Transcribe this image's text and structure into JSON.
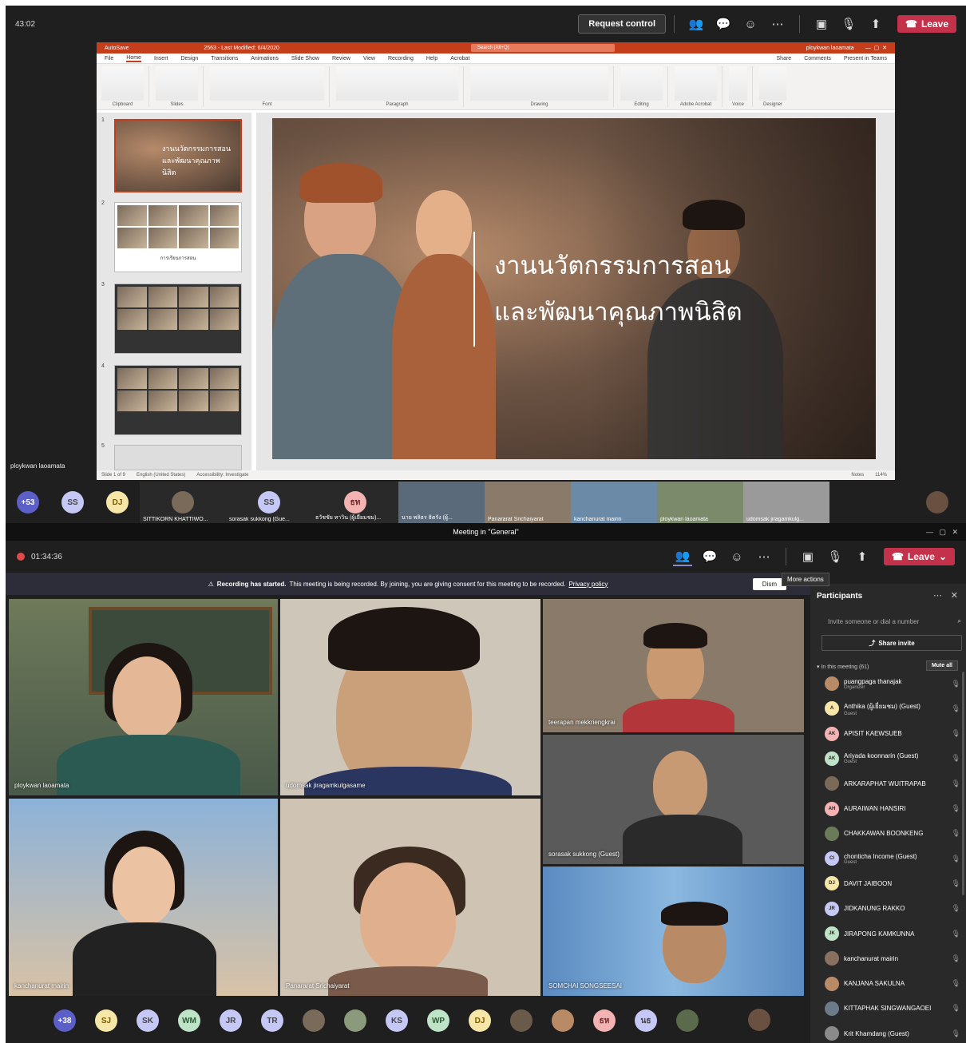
{
  "top_window": {
    "timer": "43:02",
    "request_control": "Request control",
    "leave": "Leave",
    "presenter_name": "ploykwan laoamata",
    "ppt": {
      "autosave": "AutoSave",
      "file_info": "2563 - Last Modified: 6/4/2020",
      "search": "Search (Alt+Q)",
      "user": "ploykwan laoamata",
      "menu": [
        "File",
        "Home",
        "Insert",
        "Design",
        "Transitions",
        "Animations",
        "Slide Show",
        "Review",
        "View",
        "Recording",
        "Help",
        "Acrobat"
      ],
      "share": "Share",
      "comments": "Comments",
      "present_teams": "Present in Teams",
      "ribbon_groups": [
        "Clipboard",
        "Slides",
        "Font",
        "Paragraph",
        "Drawing",
        "Editing",
        "Adobe Acrobat",
        "Voice",
        "Designer"
      ],
      "slide_numbers": [
        "1",
        "2",
        "3",
        "4",
        "5"
      ],
      "thumb_captions": [
        "งานนวัตกรรมการสอน และพัฒนาคุณภาพนิสิต",
        "การเรียนการสอน",
        "",
        "",
        ""
      ],
      "slide_title_line1": "งานนวัตกรรมการสอน",
      "slide_title_line2": "และพัฒนาคุณภาพนิสิต",
      "status_slide": "Slide 1 of 9",
      "status_lang": "English (United States)",
      "status_access": "Accessibility: Investigate",
      "status_notes": "Notes",
      "zoom": "114%"
    },
    "strip": [
      {
        "initials": "+53",
        "bg": "#5b5fc7",
        "fg": "#fff"
      },
      {
        "initials": "SS",
        "bg": "#c5c7f5",
        "fg": "#444"
      },
      {
        "initials": "DJ",
        "bg": "#f6e7a9",
        "fg": "#7a5a00"
      }
    ],
    "strip_names": [
      "SITTIKORN KHATTIWO...",
      "sorasak sukkong (Gue...",
      "ธวัชชัย ทาวิน (ผู้เยี่ยมชม)...",
      "นาย พลิธร ธิตรัง (ผู้...",
      "Panararat Srichaiyarat",
      "kanchanurat mairin",
      "ploykwan laoamata",
      "udomsak jiragamkulg..."
    ],
    "strip_initials_mid": {
      "ss": "SS",
      "tn": "ธท"
    }
  },
  "bottom_window": {
    "window_title": "Meeting in \"General\"",
    "timer": "01:34:36",
    "leave": "Leave",
    "tooltip": "More actions",
    "banner_bold": "Recording has started.",
    "banner_text": "This meeting is being recorded. By joining, you are giving consent for this meeting to be recorded.",
    "banner_link": "Privacy policy",
    "dismiss": "Dism",
    "videos": {
      "ploykwan": "ploykwan laoamata",
      "udomsak": "udomsak jiragamkulgasame",
      "teerapan": "teerapan mekkriengkrai",
      "sorasak": "sorasak sukkong (Guest)",
      "kanchanurat": "kanchanurat mairin",
      "panararat": "Panararat Srichaiyarat",
      "somchai": "SOMCHAI SONGSEESAI"
    },
    "participants": {
      "title": "Participants",
      "invite_placeholder": "Invite someone or dial a number",
      "share_invite": "Share invite",
      "in_meeting": "In this meeting (61)",
      "mute_all": "Mute all",
      "list": [
        {
          "name": "puangpaga thanajak",
          "sub": "Organizer",
          "initials": "",
          "bg": "#b98a66"
        },
        {
          "name": "Anthika (ผู้เยี่ยมชม) (Guest)",
          "sub": "Guest",
          "initials": "A",
          "bg": "#f6e7a9"
        },
        {
          "name": "APISIT KAEWSUEB",
          "sub": "",
          "initials": "AK",
          "bg": "#f4b3b3"
        },
        {
          "name": "Ariyada koonnarin (Guest)",
          "sub": "Guest",
          "initials": "AK",
          "bg": "#bfe3c7"
        },
        {
          "name": "ARKARAPHAT WUITRAPAB",
          "sub": "",
          "initials": "",
          "bg": "#7c6a58"
        },
        {
          "name": "AURAIWAN HANSIRI",
          "sub": "",
          "initials": "AH",
          "bg": "#f4b3b3"
        },
        {
          "name": "CHAKKAWAN BOONKENG",
          "sub": "",
          "initials": "",
          "bg": "#6b7b5a"
        },
        {
          "name": "chonticha Income (Guest)",
          "sub": "Guest",
          "initials": "CI",
          "bg": "#c5c7f5"
        },
        {
          "name": "DAVIT JAIBOON",
          "sub": "",
          "initials": "DJ",
          "bg": "#f6e7a9"
        },
        {
          "name": "JIDKANUNG RAKKO",
          "sub": "",
          "initials": "JR",
          "bg": "#c5c7f5"
        },
        {
          "name": "JIRAPONG KAMKUNNA",
          "sub": "",
          "initials": "JK",
          "bg": "#bfe3c7"
        },
        {
          "name": "kanchanurat mairin",
          "sub": "",
          "initials": "",
          "bg": "#8a7060"
        },
        {
          "name": "KANJANA SAKULNA",
          "sub": "",
          "initials": "",
          "bg": "#b98a66"
        },
        {
          "name": "KITTAPHAK SINGWANGAOEI",
          "sub": "",
          "initials": "",
          "bg": "#6b7b8a"
        },
        {
          "name": "Krit Khamdang (Guest)",
          "sub": "",
          "initials": "",
          "bg": "#8a8a8a"
        }
      ]
    },
    "strip": [
      {
        "initials": "+38",
        "bg": "#5b5fc7",
        "fg": "#fff"
      },
      {
        "initials": "SJ",
        "bg": "#f6e7a9",
        "fg": "#7a5a00"
      },
      {
        "initials": "SK",
        "bg": "#c5c7f5",
        "fg": "#444"
      },
      {
        "initials": "WM",
        "bg": "#bfe3c7",
        "fg": "#2d5a36"
      },
      {
        "initials": "JR",
        "bg": "#c5c7f5",
        "fg": "#444"
      },
      {
        "initials": "TR",
        "bg": "#c5c7f5",
        "fg": "#444"
      },
      {
        "initials": "",
        "bg": "#7a6a5a",
        "fg": "#fff"
      },
      {
        "initials": "",
        "bg": "#8a9a7a",
        "fg": "#fff"
      },
      {
        "initials": "KS",
        "bg": "#c5c7f5",
        "fg": "#444"
      },
      {
        "initials": "WP",
        "bg": "#bfe3c7",
        "fg": "#2d5a36"
      },
      {
        "initials": "DJ",
        "bg": "#f6e7a9",
        "fg": "#7a5a00"
      },
      {
        "initials": "",
        "bg": "#6a5a4a",
        "fg": "#fff"
      },
      {
        "initials": "",
        "bg": "#b98a66",
        "fg": "#fff"
      },
      {
        "initials": "ธห",
        "bg": "#f4b3b3",
        "fg": "#6a2a2a"
      },
      {
        "initials": "นธ",
        "bg": "#c5c7f5",
        "fg": "#444"
      },
      {
        "initials": "",
        "bg": "#5a6a4a",
        "fg": "#fff"
      }
    ]
  }
}
